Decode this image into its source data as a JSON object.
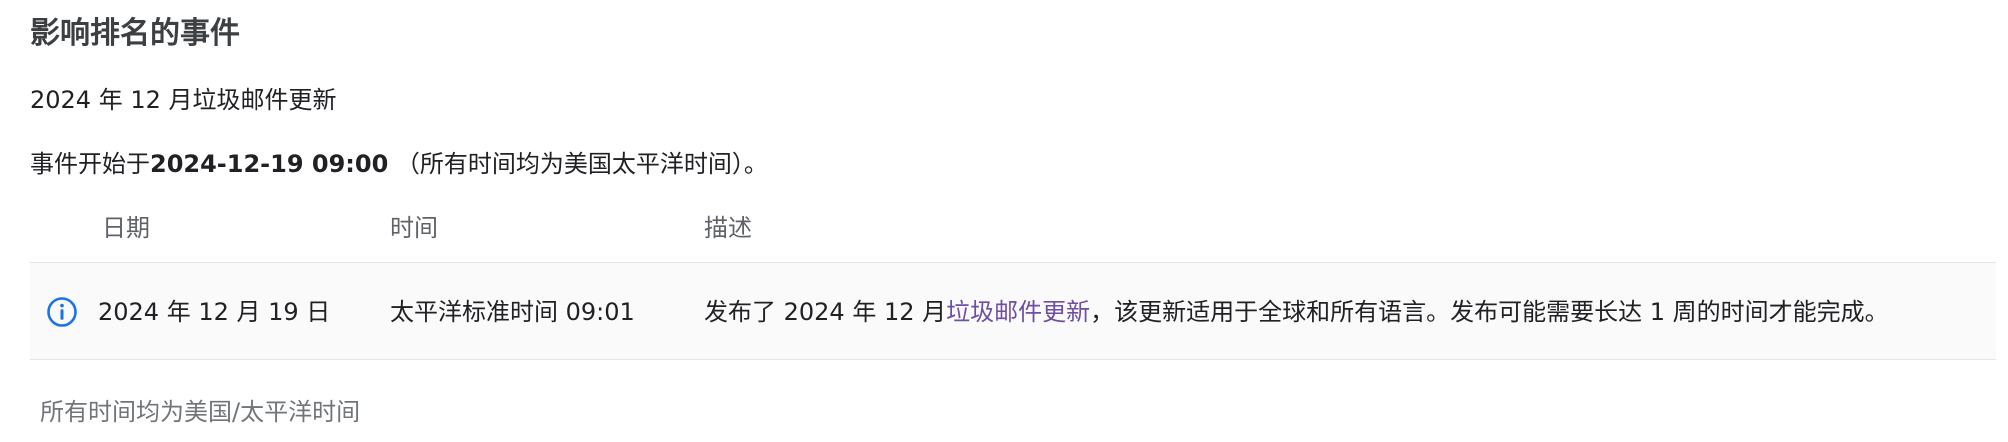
{
  "page": {
    "title": "影响排名的事件",
    "incident_name": "2024 年 12 月垃圾邮件更新",
    "start_prefix": "事件开始于",
    "start_time": "2024-12-19 09:00",
    "start_suffix": " （所有时间均为美国太平洋时间）。"
  },
  "table": {
    "headers": {
      "date": "日期",
      "time": "时间",
      "description": "描述"
    },
    "rows": [
      {
        "icon": "info-icon",
        "date": "2024 年 12 月 19 日",
        "time": "太平洋标准时间 09:01",
        "desc_before": "发布了 2024 年 12 月",
        "desc_link": "垃圾邮件更新",
        "desc_after": "，该更新适用于全球和所有语言。发布可能需要长达 1 周的时间才能完成。"
      }
    ]
  },
  "footer": {
    "note": "所有时间均为美国/太平洋时间"
  },
  "colors": {
    "link": "#6e4fa3",
    "info_icon": "#1a73e8",
    "row_background": "#fafafa"
  }
}
